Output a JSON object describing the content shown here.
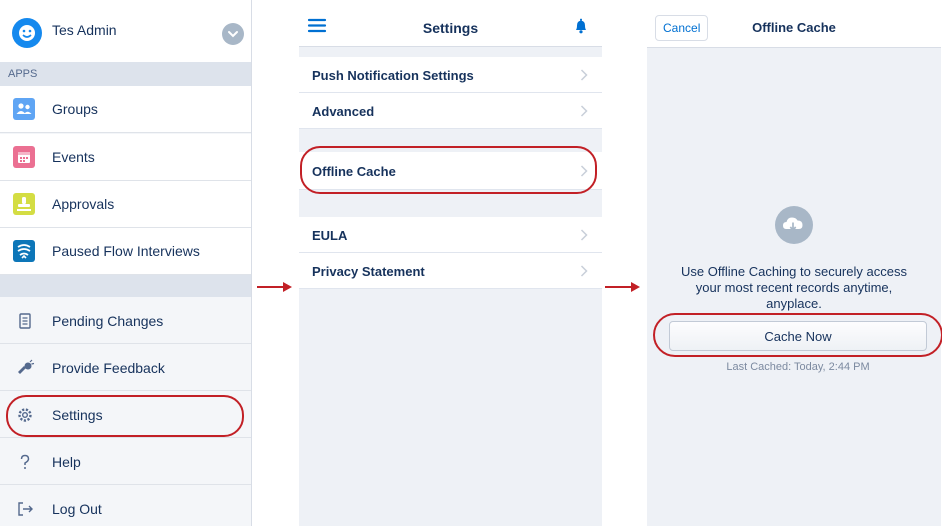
{
  "nav_menu": {
    "user_name": "Tes Admin",
    "section_label": "APPS",
    "apps": [
      {
        "label": "Groups",
        "icon": "groups-icon",
        "color": "#5fa5f4"
      },
      {
        "label": "Events",
        "icon": "calendar-icon",
        "color": "#eb7092"
      },
      {
        "label": "Approvals",
        "icon": "approval-stamp-icon",
        "color": "#d4dd43"
      },
      {
        "label": "Paused Flow Interviews",
        "icon": "flow-icon",
        "color": "#0d76b8"
      }
    ],
    "utilities": [
      {
        "label": "Pending Changes",
        "icon": "pending-changes-icon"
      },
      {
        "label": "Provide Feedback",
        "icon": "feedback-icon"
      },
      {
        "label": "Settings",
        "icon": "gear-icon"
      },
      {
        "label": "Help",
        "icon": "question-icon"
      },
      {
        "label": "Log Out",
        "icon": "logout-icon"
      }
    ]
  },
  "settings": {
    "title": "Settings",
    "rows": [
      {
        "label": "Push Notification Settings"
      },
      {
        "label": "Advanced"
      },
      {
        "label": "Offline Cache"
      },
      {
        "label": "EULA"
      },
      {
        "label": "Privacy Statement"
      }
    ]
  },
  "offline_cache": {
    "cancel_label": "Cancel",
    "title": "Offline Cache",
    "message": "Use Offline Caching to securely access your most recent records anytime, anyplace.",
    "cache_button_label": "Cache Now",
    "last_cached": "Last Cached: Today, 2:44 PM"
  },
  "colors": {
    "brand_blue": "#0070d2",
    "highlight_red": "#c22026",
    "text_navy": "#16325c"
  }
}
